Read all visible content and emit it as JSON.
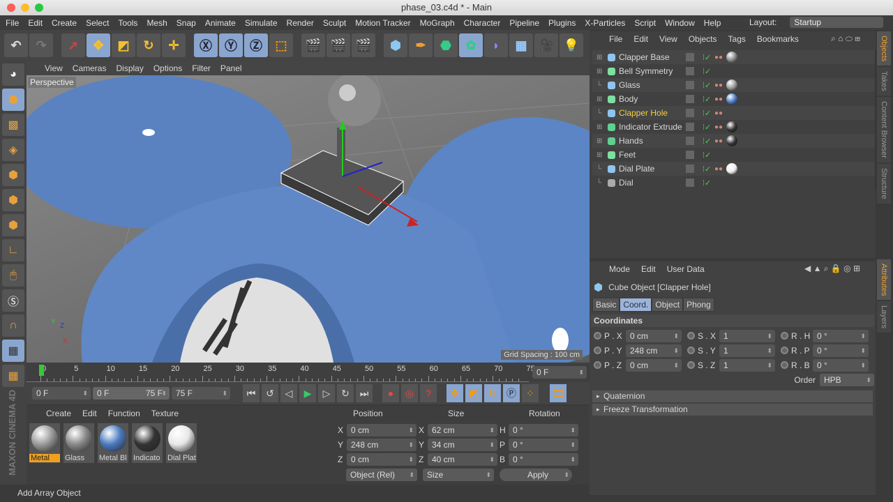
{
  "window": {
    "title": "phase_03.c4d * - Main"
  },
  "menu": [
    "File",
    "Edit",
    "Create",
    "Select",
    "Tools",
    "Mesh",
    "Snap",
    "Animate",
    "Simulate",
    "Render",
    "Sculpt",
    "Motion Tracker",
    "MoGraph",
    "Character",
    "Pipeline",
    "Plugins",
    "X-Particles",
    "Script",
    "Window",
    "Help"
  ],
  "layout": {
    "label": "Layout:",
    "value": "Startup"
  },
  "viewport": {
    "menu": [
      "View",
      "Cameras",
      "Display",
      "Options",
      "Filter",
      "Panel"
    ],
    "camera": "Perspective",
    "grid_spacing": "Grid Spacing : 100 cm"
  },
  "timeline": {
    "ticks": [
      "0",
      "5",
      "10",
      "15",
      "20",
      "25",
      "30",
      "35",
      "40",
      "45",
      "50",
      "55",
      "60",
      "65",
      "70",
      "75"
    ],
    "current_frame": "0 F",
    "start": "0 F",
    "range_start": "0 F",
    "range_end": "75 F",
    "end": "75 F"
  },
  "materials": {
    "menu": [
      "Create",
      "Edit",
      "Function",
      "Texture"
    ],
    "items": [
      {
        "name": "Metal",
        "color": "#9a9a9a"
      },
      {
        "name": "Glass",
        "color": "#888"
      },
      {
        "name": "Metal Bl",
        "color": "#4a7ac0"
      },
      {
        "name": "Indicato",
        "color": "#333"
      },
      {
        "name": "Dial Plat",
        "color": "#e8e8e8"
      }
    ]
  },
  "coords": {
    "headers": [
      "Position",
      "Size",
      "Rotation"
    ],
    "rows": [
      {
        "pl": "X",
        "p": "0 cm",
        "sl": "X",
        "s": "62 cm",
        "rl": "H",
        "r": "0 °"
      },
      {
        "pl": "Y",
        "p": "248 cm",
        "sl": "Y",
        "s": "34 cm",
        "rl": "P",
        "r": "0 °"
      },
      {
        "pl": "Z",
        "p": "0 cm",
        "sl": "Z",
        "s": "40 cm",
        "rl": "B",
        "r": "0 °"
      }
    ],
    "mode": "Object (Rel)",
    "size_mode": "Size",
    "apply": "Apply"
  },
  "status": "Add Array Object",
  "objects": {
    "menu": [
      "File",
      "Edit",
      "View",
      "Objects",
      "Tags",
      "Bookmarks"
    ],
    "items": [
      {
        "name": "Clapper Base",
        "icon": "#8fc4f0",
        "mat": "#888"
      },
      {
        "name": "Bell Symmetry",
        "icon": "#7de0a0",
        "mat": null
      },
      {
        "name": "Glass",
        "icon": "#8fc4f0",
        "mat": "#999"
      },
      {
        "name": "Body",
        "icon": "#7de0a0",
        "mat": "#4a7ac0"
      },
      {
        "name": "Clapper Hole",
        "icon": "#8fc4f0",
        "mat": null,
        "selected": true
      },
      {
        "name": "Indicator Extrude",
        "icon": "#5fd090",
        "mat": "#333"
      },
      {
        "name": "Hands",
        "icon": "#5fd090",
        "mat": "#333"
      },
      {
        "name": "Feet",
        "icon": "#7de0a0",
        "mat": null
      },
      {
        "name": "Dial Plate",
        "icon": "#8fc4f0",
        "mat": "#eee"
      },
      {
        "name": "Dial",
        "icon": "#aaa",
        "mat": null
      }
    ]
  },
  "attributes": {
    "menu": [
      "Mode",
      "Edit",
      "User Data"
    ],
    "title": "Cube Object [Clapper Hole]",
    "tabs": [
      "Basic",
      "Coord.",
      "Object",
      "Phong"
    ],
    "active_tab": "Coord.",
    "section": "Coordinates",
    "rows": [
      {
        "a": "P . X",
        "av": "0 cm",
        "b": "S . X",
        "bv": "1",
        "c": "R . H",
        "cv": "0 °"
      },
      {
        "a": "P . Y",
        "av": "248 cm",
        "b": "S . Y",
        "bv": "1",
        "c": "R . P",
        "cv": "0 °"
      },
      {
        "a": "P . Z",
        "av": "0 cm",
        "b": "S . Z",
        "bv": "1",
        "c": "R . B",
        "cv": "0 °"
      }
    ],
    "order_label": "Order",
    "order": "HPB",
    "sections": [
      "Quaternion",
      "Freeze Transformation"
    ]
  },
  "side_tabs": [
    "Objects",
    "Takes",
    "Content Browser",
    "Structure",
    "Attributes",
    "Layers"
  ],
  "brand": "MAXON CINEMA 4D"
}
